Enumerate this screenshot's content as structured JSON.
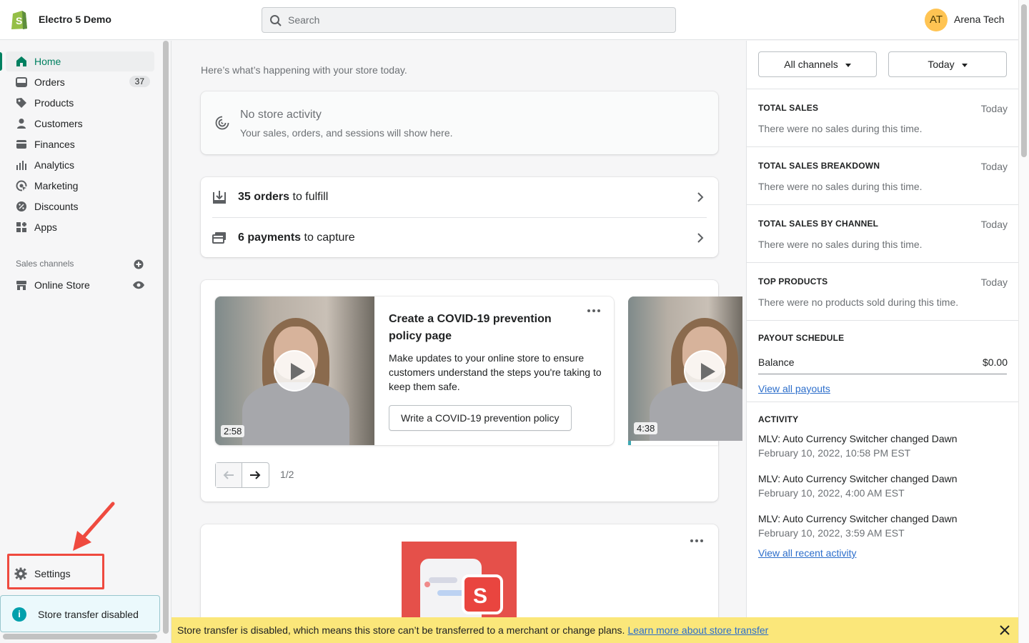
{
  "header": {
    "store_name": "Electro 5 Demo",
    "search_placeholder": "Search",
    "user_initials": "AT",
    "user_name": "Arena Tech"
  },
  "sidebar": {
    "items": [
      {
        "label": "Home",
        "icon": "home-icon"
      },
      {
        "label": "Orders",
        "icon": "orders-icon",
        "badge": "37"
      },
      {
        "label": "Products",
        "icon": "tag-icon"
      },
      {
        "label": "Customers",
        "icon": "person-icon"
      },
      {
        "label": "Finances",
        "icon": "finance-icon"
      },
      {
        "label": "Analytics",
        "icon": "bar-chart-icon"
      },
      {
        "label": "Marketing",
        "icon": "target-icon"
      },
      {
        "label": "Discounts",
        "icon": "discount-icon"
      },
      {
        "label": "Apps",
        "icon": "apps-icon"
      }
    ],
    "sales_channels_label": "Sales channels",
    "online_store_label": "Online Store",
    "settings_label": "Settings",
    "transfer_notice": "Store transfer disabled"
  },
  "main": {
    "intro": "Here’s what’s happening with your store today.",
    "no_activity_title": "No store activity",
    "no_activity_sub": "Your sales, orders, and sessions will show here.",
    "tasks": [
      {
        "bold": "35 orders",
        "rest": " to fulfill"
      },
      {
        "bold": "6 payments",
        "rest": " to capture"
      }
    ],
    "slide": {
      "title": "Create a COVID-19 prevention policy page",
      "body": "Make updates to your online store to ensure customers understand the steps you're taking to keep them safe.",
      "button": "Write a COVID-19 prevention policy",
      "duration": "2:58"
    },
    "slide2_duration": "4:38",
    "pager_count": "1/2"
  },
  "right_panel": {
    "channel_select": "All channels",
    "date_select": "Today",
    "sections": [
      {
        "title": "TOTAL SALES",
        "date": "Today",
        "text": "There were no sales during this time."
      },
      {
        "title": "TOTAL SALES BREAKDOWN",
        "date": "Today",
        "text": "There were no sales during this time."
      },
      {
        "title": "TOTAL SALES BY CHANNEL",
        "date": "Today",
        "text": "There were no sales during this time."
      },
      {
        "title": "TOP PRODUCTS",
        "date": "Today",
        "text": "There were no products sold during this time."
      }
    ],
    "payout": {
      "title": "PAYOUT SCHEDULE",
      "balance_label": "Balance",
      "balance_value": "$0.00",
      "link": "View all payouts"
    },
    "activity": {
      "title": "ACTIVITY",
      "items": [
        {
          "text": "MLV: Auto Currency Switcher changed Dawn",
          "date": "February 10, 2022, 10:58 PM EST"
        },
        {
          "text": "MLV: Auto Currency Switcher changed Dawn",
          "date": "February 10, 2022, 4:00 AM EST"
        },
        {
          "text": "MLV: Auto Currency Switcher changed Dawn",
          "date": "February 10, 2022, 3:59 AM EST"
        }
      ],
      "link": "View all recent activity"
    }
  },
  "banner": {
    "text": "Store transfer is disabled, which means this store can’t be transferred to a merchant or change plans.",
    "link": "Learn more about store transfer"
  },
  "colors": {
    "accent_green": "#008060",
    "link_blue": "#2c6ecb",
    "banner_yellow": "#fbe77a",
    "annotation_red": "#ef4a3f"
  }
}
